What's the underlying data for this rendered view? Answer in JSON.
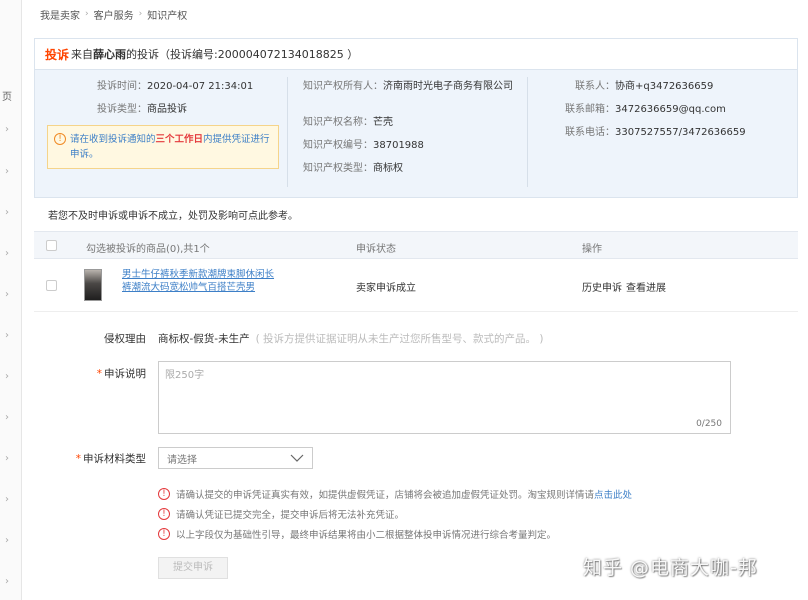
{
  "breadcrumb": [
    "我是卖家",
    "客户服务",
    "知识产权"
  ],
  "complaint": {
    "tag": "投诉",
    "from_prefix": "来自",
    "complainant": "薛心雨",
    "from_suffix": "的投诉（投诉编号:200004072134018825 ）",
    "time_label": "投诉时间：",
    "time_value": "2020-04-07 21:34:01",
    "type_label": "投诉类型：",
    "type_value": "商品投诉",
    "notice_a": "请在收到投诉通知的",
    "notice_b": "三个工作日",
    "notice_c": "内提供凭证进行申诉。",
    "ip_owner_label": "知识产权所有人：",
    "ip_owner_value": "济南雨时光电子商务有限公司",
    "ip_name_label": "知识产权名称：",
    "ip_name_value": "芒壳",
    "ip_no_label": "知识产权编号：",
    "ip_no_value": "38701988",
    "ip_type_label": "知识产权类型：",
    "ip_type_value": "商标权",
    "contact_label": "联系人：",
    "contact_value": "协商+q3472636659",
    "email_label": "联系邮箱：",
    "email_value": "3472636659@qq.com",
    "phone_label": "联系电话：",
    "phone_value": "3307527557/3472636659"
  },
  "warning_line": "若您不及时申诉或申诉不成立，处罚及影响可点此参考。",
  "table": {
    "headers": [
      "勾选被投诉的商品(0),共1个",
      "申诉状态",
      "操作"
    ],
    "row": {
      "product": "男士牛仔裤秋季新款潮牌束脚休闲长裤潮流大码宽松帅气百搭芒壳男",
      "status": "卖家申诉成立",
      "op1": "历史申诉",
      "op2": "查看进展"
    }
  },
  "form": {
    "reason_label": "侵权理由",
    "reason_value": "商标权-假货-未生产",
    "reason_hint": "( 投诉方提供证据证明从未生产过您所售型号、款式的产品。 )",
    "desc_label": "申诉说明",
    "desc_placeholder": "限250字",
    "desc_counter": "0/250",
    "material_label": "申诉材料类型",
    "material_placeholder": "请选择",
    "tip1_a": "请确认提交的申诉凭证真实有效，如提供虚假凭证，店铺将会被追加虚假凭证处罚。淘宝规则详情请",
    "tip1_link": "点击此处",
    "tip2": "请确认凭证已提交完全，提交申诉后将无法补充凭证。",
    "tip3": "以上字段仅为基础性引导，最终申诉结果将由小二根据整体投申诉情况进行综合考量判定。",
    "submit_label": "提交申诉"
  },
  "sidebar": {
    "label": "页"
  },
  "watermark": "知乎 @电商大咖-邦"
}
